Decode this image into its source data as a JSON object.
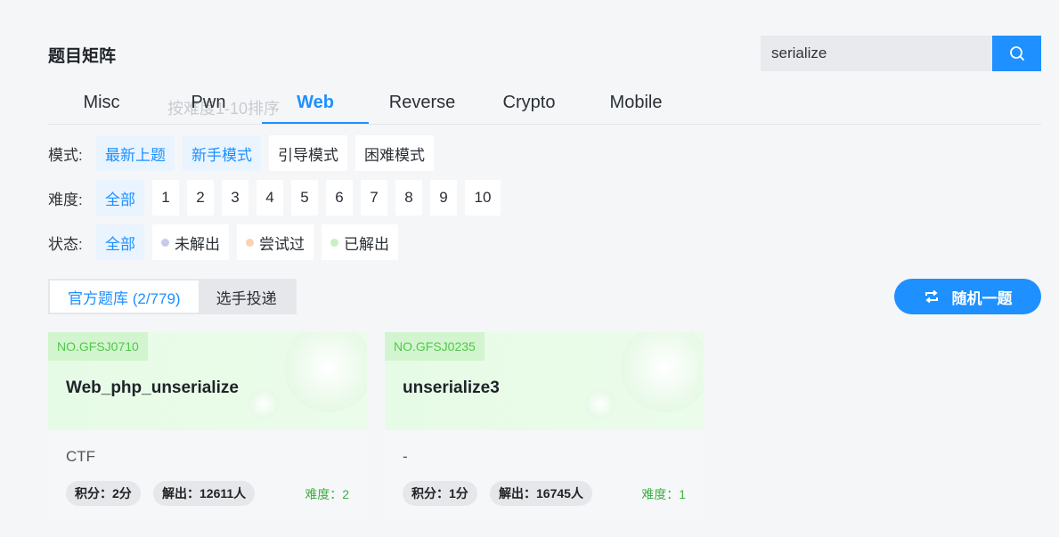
{
  "page": {
    "title": "题目矩阵"
  },
  "search": {
    "value": "serialize"
  },
  "tabs": [
    "Misc",
    "Pwn",
    "Web",
    "Reverse",
    "Crypto",
    "Mobile"
  ],
  "active_tab": "Web",
  "ghost_text": "按难度1-10排序",
  "filters": {
    "mode": {
      "label": "模式:",
      "options": [
        "最新上题",
        "新手模式",
        "引导模式",
        "困难模式"
      ]
    },
    "difficulty": {
      "label": "难度:",
      "options": [
        "全部",
        "1",
        "2",
        "3",
        "4",
        "5",
        "6",
        "7",
        "8",
        "9",
        "10"
      ]
    },
    "status": {
      "label": "状态:",
      "options": [
        "全部",
        "未解出",
        "尝试过",
        "已解出"
      ],
      "dot_colors": [
        "#c5cbe9",
        "#fbd2b5",
        "#c7f0c5"
      ]
    }
  },
  "source": {
    "official": "官方题库 (2/779)",
    "player": "选手投递"
  },
  "random_button": "随机一题",
  "cards": [
    {
      "no": "NO.GFSJ0710",
      "name": "Web_php_unserialize",
      "category": "CTF",
      "score": "积分：2分",
      "solved": "解出：12611人",
      "difficulty": "难度：2"
    },
    {
      "no": "NO.GFSJ0235",
      "name": "unserialize3",
      "category": "-",
      "score": "积分：1分",
      "solved": "解出：16745人",
      "difficulty": "难度：1"
    }
  ],
  "colors": {
    "accent": "#1e90ff",
    "card_green": "#52c84a",
    "difficulty_green": "#3cb043"
  }
}
